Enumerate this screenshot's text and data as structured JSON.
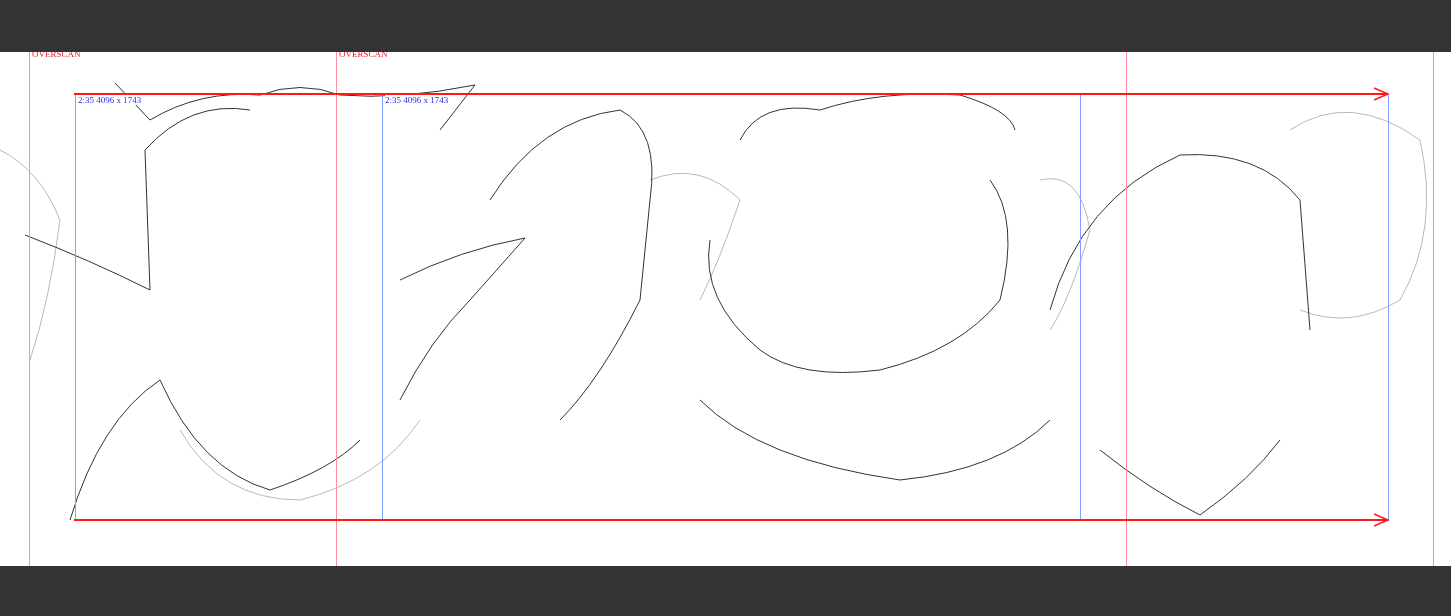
{
  "canvas": {
    "overscan_labels": [
      "OVERSCAN",
      "OVERSCAN"
    ],
    "frame_labels": [
      "2:35 4096 x 1743",
      "2:35 4096 x 1743"
    ]
  }
}
